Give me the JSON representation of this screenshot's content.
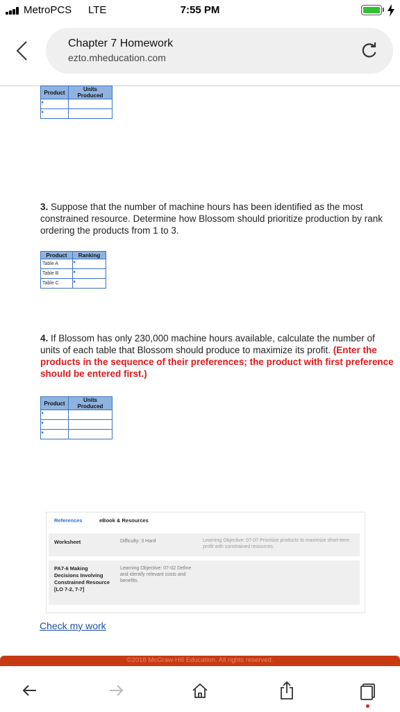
{
  "status_bar": {
    "carrier": "MetroPCS",
    "network": "LTE",
    "time": "7:55 PM",
    "battery_level": 1.0,
    "battery_color": "#2fc42f"
  },
  "browser": {
    "page_title": "Chapter 7 Homework",
    "url": "ezto.mheducation.com",
    "icons": [
      "back-chevron-icon",
      "reload-icon"
    ]
  },
  "table_units_top": {
    "headers": [
      "Product",
      "Units Produced"
    ],
    "rows": [
      [
        "",
        ""
      ],
      [
        "",
        ""
      ]
    ]
  },
  "question3": {
    "number": "3.",
    "text": " Suppose that the number of machine hours has been identified as the most constrained resource. Determine how Blossom should prioritize production by rank ordering the products from 1 to 3."
  },
  "table_ranking": {
    "headers": [
      "Product",
      "Ranking"
    ],
    "rows": [
      [
        "Table A",
        ""
      ],
      [
        "Table B",
        ""
      ],
      [
        "Table C",
        ""
      ]
    ]
  },
  "question4": {
    "number": "4.",
    "text": " If Blossom has only 230,000 machine hours available, calculate the number of units of each table that Blossom should produce to maximize its profit. ",
    "emphasis": "(Enter the products in the sequence of their preferences; the product with first preference should be entered first.)"
  },
  "table_units_q4": {
    "headers": [
      "Product",
      "Units Produced"
    ],
    "rows": [
      [
        "",
        ""
      ],
      [
        "",
        ""
      ],
      [
        "",
        ""
      ]
    ]
  },
  "references": {
    "tab_references": "References",
    "tab_ebook": "eBook & Resources",
    "worksheet_label": "Worksheet",
    "difficulty": "Difficulty: 3 Hard",
    "objective1": "Learning Objective: 07-07 Prioritize products to maximize short-term profit with constrained resources.",
    "pa_title": "PA7-6 Making Decisions Involving Constrained Resource [LO 7-2, 7-7]",
    "objective2": "Learning Objective: 07-02 Define and identify relevant costs and benefits."
  },
  "check_link": "Check my work",
  "footer": "©2018 McGraw-Hill Education. All rights reserved.",
  "toolbar_icons": [
    "back-arrow-icon",
    "forward-arrow-icon",
    "home-icon",
    "share-icon",
    "tabs-icon"
  ]
}
